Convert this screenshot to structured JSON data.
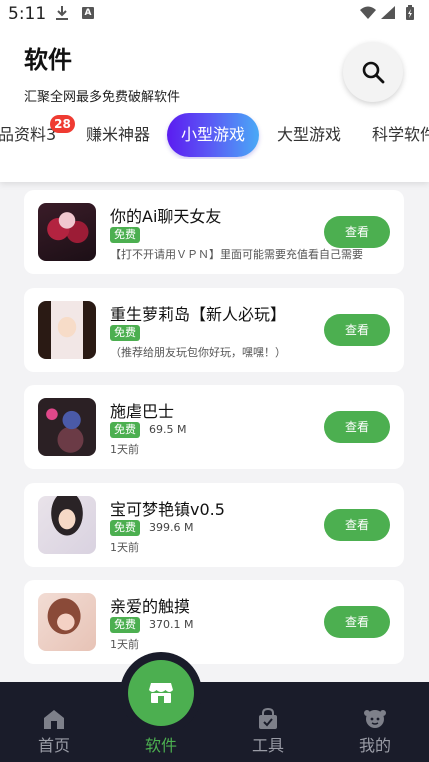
{
  "status_bar": {
    "time": "5:11",
    "notif_a": "A"
  },
  "header": {
    "title": "软件",
    "subtitle": "汇聚全网最多免费破解软件"
  },
  "tabs": [
    {
      "label": "品资料3",
      "badge": "28"
    },
    {
      "label": "赚米神器"
    },
    {
      "label": "小型游戏",
      "active": true
    },
    {
      "label": "大型游戏"
    },
    {
      "label": "科学软件"
    }
  ],
  "apps": [
    {
      "name": "你的Ai聊天女友",
      "tag": "免费",
      "size": "",
      "desc": "【打不开请用ＶＰＮ】里面可能需要充值看自己需要",
      "action": "查看"
    },
    {
      "name": "重生萝莉岛【新人必玩】",
      "tag": "免费",
      "size": "",
      "desc": "（推荐给朋友玩包你好玩，嘿嘿！）",
      "action": "查看"
    },
    {
      "name": "施虐巴士",
      "tag": "免费",
      "size": "69.5 M",
      "desc": "1天前",
      "action": "查看"
    },
    {
      "name": "宝可梦艳镇v0.5",
      "tag": "免费",
      "size": "399.6 M",
      "desc": "1天前",
      "action": "查看"
    },
    {
      "name": "亲爱的触摸",
      "tag": "免费",
      "size": "370.1 M",
      "desc": "1天前",
      "action": "查看"
    }
  ],
  "bottom_nav": [
    {
      "label": "首页",
      "icon": "home-icon"
    },
    {
      "label": "软件",
      "icon": "store-icon",
      "active": true
    },
    {
      "label": "工具",
      "icon": "bag-icon"
    },
    {
      "label": "我的",
      "icon": "profile-icon"
    }
  ],
  "colors": {
    "accent_green": "#4caf50",
    "tab_gradient_start": "#5b1cf0",
    "tab_gradient_end": "#4aa9f6",
    "badge_red": "#ef3b32",
    "nav_background": "#1a1c2a"
  }
}
